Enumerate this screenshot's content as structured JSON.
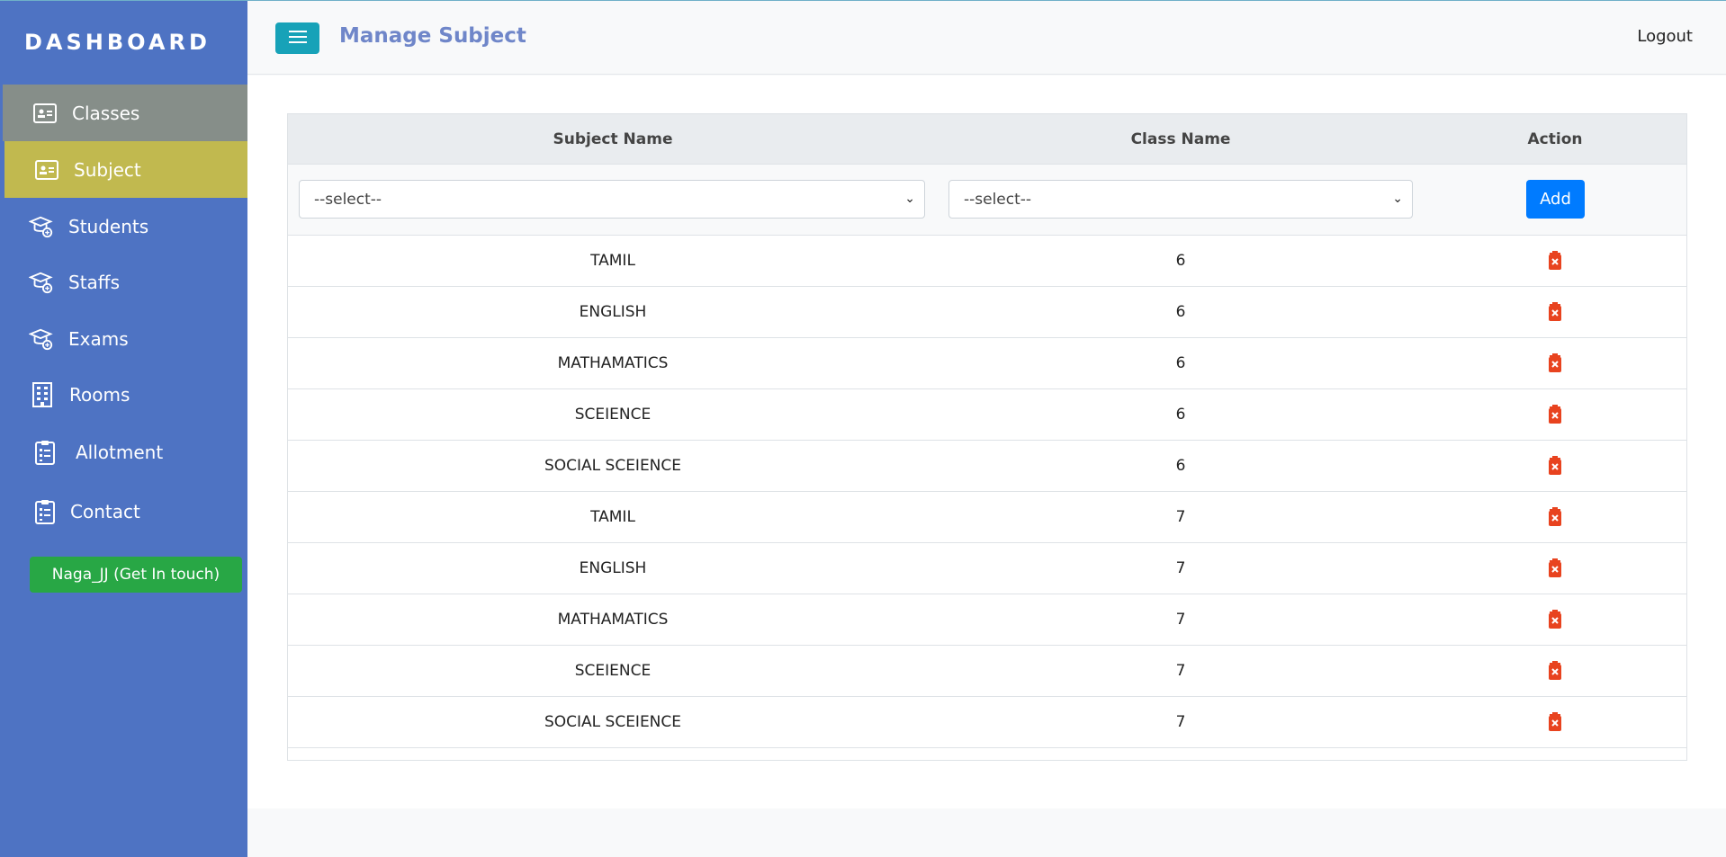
{
  "sidebar": {
    "brand": "DASHBOARD",
    "items": [
      {
        "label": "Classes",
        "icon": "id-card-icon"
      },
      {
        "label": "Subject",
        "icon": "id-card-icon"
      },
      {
        "label": "Students",
        "icon": "graduate-icon"
      },
      {
        "label": "Staffs",
        "icon": "graduate-icon"
      },
      {
        "label": "Exams",
        "icon": "graduate-icon"
      },
      {
        "label": "Rooms",
        "icon": "building-icon"
      },
      {
        "label": "Allotment",
        "icon": "clipboard-icon"
      },
      {
        "label": "Contact",
        "icon": "clipboard-icon"
      }
    ],
    "contact_button": "Naga_JJ (Get In touch)"
  },
  "header": {
    "title": "Manage Subject",
    "logout": "Logout"
  },
  "table": {
    "headers": [
      "Subject Name",
      "Class Name",
      "Action"
    ],
    "subject_select": "--select--",
    "class_select": "--select--",
    "add_label": "Add",
    "rows": [
      {
        "subject": "TAMIL",
        "class": "6"
      },
      {
        "subject": "ENGLISH",
        "class": "6"
      },
      {
        "subject": "MATHAMATICS",
        "class": "6"
      },
      {
        "subject": "SCEIENCE",
        "class": "6"
      },
      {
        "subject": "SOCIAL SCEIENCE",
        "class": "6"
      },
      {
        "subject": "TAMIL",
        "class": "7"
      },
      {
        "subject": "ENGLISH",
        "class": "7"
      },
      {
        "subject": "MATHAMATICS",
        "class": "7"
      },
      {
        "subject": "SCEIENCE",
        "class": "7"
      },
      {
        "subject": "SOCIAL SCEIENCE",
        "class": "7"
      }
    ]
  },
  "colors": {
    "sidebar": "#4e73c3",
    "classes_active": "#868e89",
    "subject_active": "#c1b94f",
    "delete": "#e8431f"
  }
}
